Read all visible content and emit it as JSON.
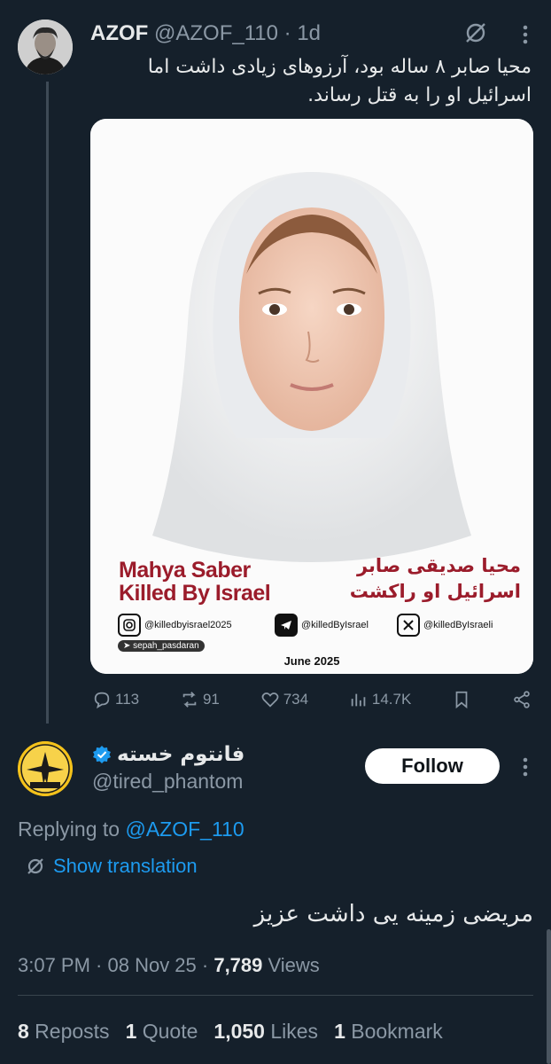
{
  "tweet": {
    "author_name": "AZOF",
    "handle": "@AZOF_110",
    "time": "1d",
    "separator": "·",
    "text_line1": "محیا صابر ۸ ساله بود، آرزوهای زیادی داشت اما",
    "text_line2": "اسرائیل او را به قتل رساند.",
    "media": {
      "caption_en_line1": "Mahya Saber",
      "caption_en_line2": "Killed By Israel",
      "caption_fa_line1": "محیا صدیقی صابر",
      "caption_fa_line2": "اسرائیل او راکشت",
      "instagram": "@killedbyisrael2025",
      "telegram": "@killedByIsrael",
      "x_handle": "@killedByIsraeli",
      "telegram_channel": "sepah_pasdaran",
      "date": "June 2025"
    },
    "actions": {
      "replies": "113",
      "reposts": "91",
      "likes": "734",
      "views": "14.7K"
    }
  },
  "reply": {
    "display_name": "فانتوم خسته",
    "handle": "@tired_phantom",
    "follow_label": "Follow",
    "replying_prefix": "Replying to ",
    "replying_to": "@AZOF_110",
    "show_translation": "Show translation",
    "text": "مریضی زمینه یی داشت عزیز",
    "time": "3:07 PM · 08 Nov 25 · ",
    "views_count": "7,789",
    "views_label": " Views",
    "stats": {
      "reposts_count": "8",
      "reposts_label": " Reposts",
      "quotes_count": "1",
      "quotes_label": " Quote",
      "likes_count": "1,050",
      "likes_label": " Likes",
      "bookmarks_count": "1",
      "bookmarks_label": " Bookmark"
    }
  },
  "colors": {
    "background": "#15202b",
    "text": "#e7e9ea",
    "muted": "#8b98a5",
    "accent": "#1d9bf0",
    "caption_red": "#9b1c2b"
  }
}
